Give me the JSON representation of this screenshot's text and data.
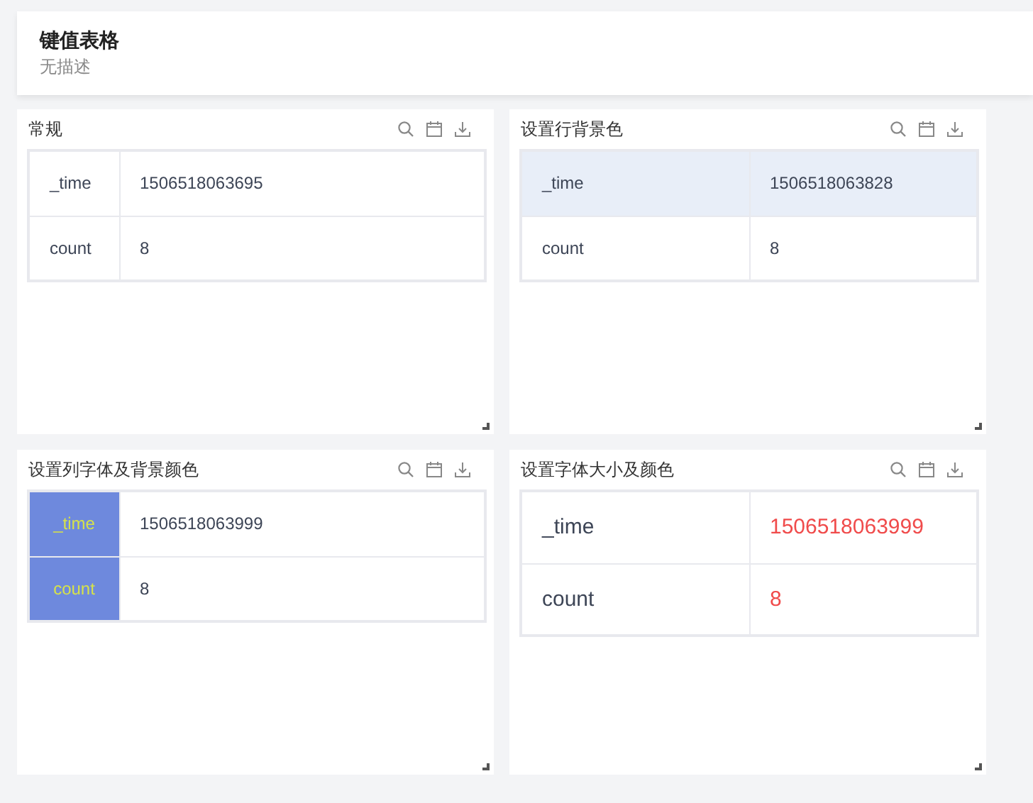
{
  "header": {
    "title": "键值表格",
    "description": "无描述"
  },
  "panels": [
    {
      "title": "常规",
      "kind": "default",
      "rows": [
        {
          "key": "_time",
          "value": "1506518063695"
        },
        {
          "key": "count",
          "value": "8"
        }
      ]
    },
    {
      "title": "设置行背景色",
      "kind": "row_background",
      "rows": [
        {
          "key": "_time",
          "value": "1506518063828",
          "highlighted": true
        },
        {
          "key": "count",
          "value": "8",
          "highlighted": false
        }
      ]
    },
    {
      "title": "设置列字体及背景颜色",
      "kind": "column_style",
      "rows": [
        {
          "key": "_time",
          "value": "1506518063999"
        },
        {
          "key": "count",
          "value": "8"
        }
      ]
    },
    {
      "title": "设置字体大小及颜色",
      "kind": "font_style",
      "rows": [
        {
          "key": "_time",
          "value": "1506518063999"
        },
        {
          "key": "count",
          "value": "8"
        }
      ]
    }
  ]
}
